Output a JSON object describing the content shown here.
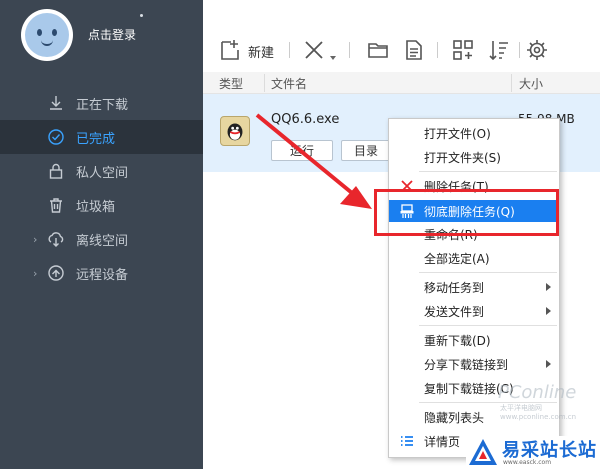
{
  "sidebar": {
    "login_text": "点击登录",
    "items": [
      {
        "label": "正在下载",
        "icon": "download-icon"
      },
      {
        "label": "已完成",
        "icon": "check-circle-icon"
      },
      {
        "label": "私人空间",
        "icon": "lock-icon"
      },
      {
        "label": "垃圾箱",
        "icon": "trash-icon"
      },
      {
        "label": "离线空间",
        "icon": "cloud-download-icon"
      },
      {
        "label": "远程设备",
        "icon": "remote-device-icon"
      }
    ]
  },
  "toolbar": {
    "new_label": "新建"
  },
  "columns": {
    "type": "类型",
    "filename": "文件名",
    "size": "大小"
  },
  "file": {
    "name": "QQ6.6.exe",
    "size": "55.98 MB",
    "run_label": "运行",
    "dir_label": "目录"
  },
  "menu": {
    "items": [
      {
        "label": "打开文件(O)"
      },
      {
        "label": "打开文件夹(S)"
      },
      {
        "label": "删除任务(T)"
      },
      {
        "label": "彻底删除任务(Q)"
      },
      {
        "label": "重命名(R)"
      },
      {
        "label": "全部选定(A)"
      },
      {
        "label": "移动任务到"
      },
      {
        "label": "发送文件到"
      },
      {
        "label": "重新下载(D)"
      },
      {
        "label": "分享下载链接到"
      },
      {
        "label": "复制下载链接(C)"
      },
      {
        "label": "隐藏列表头"
      },
      {
        "label": "详情页"
      }
    ]
  },
  "watermarks": {
    "pconline": "PConline",
    "pconline_sub": "太平洋电脑网 www.pconline.com.cn",
    "site_name": "易采站长站",
    "site_url": "www.easck.com"
  },
  "colors": {
    "sidebar_bg": "#3c4652",
    "accent_blue": "#1a7ff0",
    "highlight_red": "#e8262c"
  }
}
